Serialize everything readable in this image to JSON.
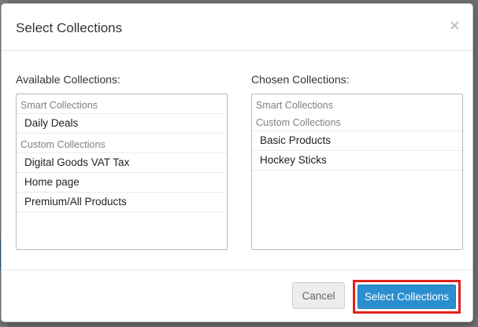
{
  "dialog": {
    "title": "Select Collections",
    "close_symbol": "×"
  },
  "available": {
    "label": "Available Collections:",
    "groups": [
      {
        "label": "Smart Collections",
        "items": [
          "Daily Deals"
        ]
      },
      {
        "label": "Custom Collections",
        "items": [
          "Digital Goods VAT Tax",
          "Home page",
          "Premium/All Products"
        ]
      }
    ]
  },
  "chosen": {
    "label": "Chosen Collections:",
    "groups": [
      {
        "label": "Smart Collections",
        "items": []
      },
      {
        "label": "Custom Collections",
        "items": [
          "Basic Products",
          "Hockey Sticks"
        ]
      }
    ]
  },
  "footer": {
    "cancel_label": "Cancel",
    "submit_label": "Select Collections"
  },
  "colors": {
    "primary": "#2a8fcf",
    "highlight": "#e0221e"
  },
  "icons": {
    "close": "close-icon"
  }
}
